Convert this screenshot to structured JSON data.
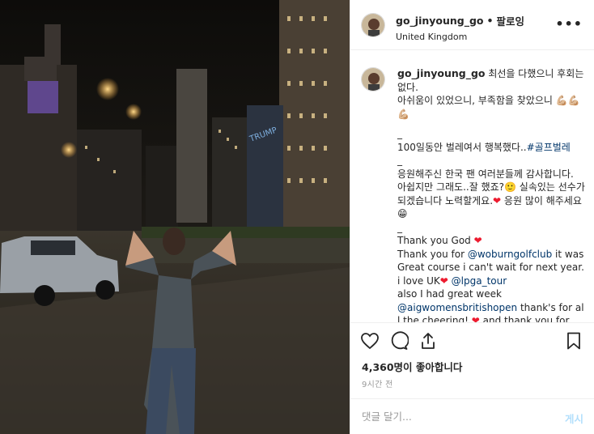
{
  "post": {
    "username": "go_jinyoung_go",
    "separator": "•",
    "follow_label": "팔로잉",
    "location": "United Kingdom",
    "more_label": "•••"
  },
  "caption": {
    "username": "go_jinyoung_go",
    "line1": " 최선을 다했으니 후회는 없다.",
    "line2": "아쉬움이 있었으니, 부족함을 찾았으니 💪🏼💪🏼💪🏼",
    "sep1": "_",
    "line3": "100일동안 벌레여서 행복했다..",
    "hashtag": "#골프벌레",
    "sep2": "_",
    "line4": "응원해주신 한국 팬 여러분들께 감사합니다. 아쉽지만 그래도..잘 했죠?🙂 실속있는 선수가 되겠습니다 노력할게요.",
    "line4_heart": "❤",
    "line4_end": " 응원 많이 해주세요😁",
    "sep3": "_",
    "line5": "Thank you God ",
    "line5_heart": "❤",
    "line6_a": "Thank you for ",
    "mention1": "@woburngolfclub",
    "line6_b": " it was Great course i can't wait for next year. i love UK",
    "line6_heart": "❤",
    "mention2": " @lpga_tour",
    "line7": "also I had great week",
    "mention3": "@aigwomensbritishopen",
    "line8": " thank's for all the cheering! ",
    "line8_heart": "❤",
    "line8_end": " and thank you for"
  },
  "engagement": {
    "likes": "4,360명이 좋아합니다",
    "time": "9시간 전"
  },
  "comment": {
    "placeholder": "댓글 달기...",
    "post_label": "게시"
  }
}
